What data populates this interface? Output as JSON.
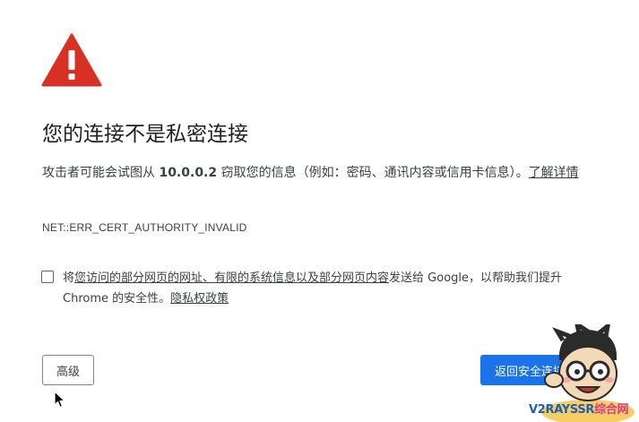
{
  "heading": "您的连接不是私密连接",
  "description": {
    "before": "攻击者可能会试图从 ",
    "host": "10.0.0.2",
    "after": " 窃取您的信息（例如：密码、通讯内容或信用卡信息）。",
    "learn_more": "了解详情"
  },
  "error_code": "NET::ERR_CERT_AUTHORITY_INVALID",
  "optin": {
    "prefix": "将",
    "link1": "您访问的部分网页的网址、有限的系统信息以及部分网页内容",
    "suffix": "发送给 Google，以帮助我们提升 Chrome 的安全性。",
    "privacy_link": "隐私权政策",
    "checked": false
  },
  "buttons": {
    "advanced": "高级",
    "back_to_safety": "返回安全连接"
  },
  "watermark": {
    "part1": "V2RAYSSR",
    "part2": "综合网"
  },
  "icons": {
    "warning": "warning-triangle-icon",
    "cursor": "mouse-pointer-icon"
  },
  "colors": {
    "warning_red": "#d93025",
    "primary_blue": "#1a73e8",
    "text": "#202124"
  }
}
